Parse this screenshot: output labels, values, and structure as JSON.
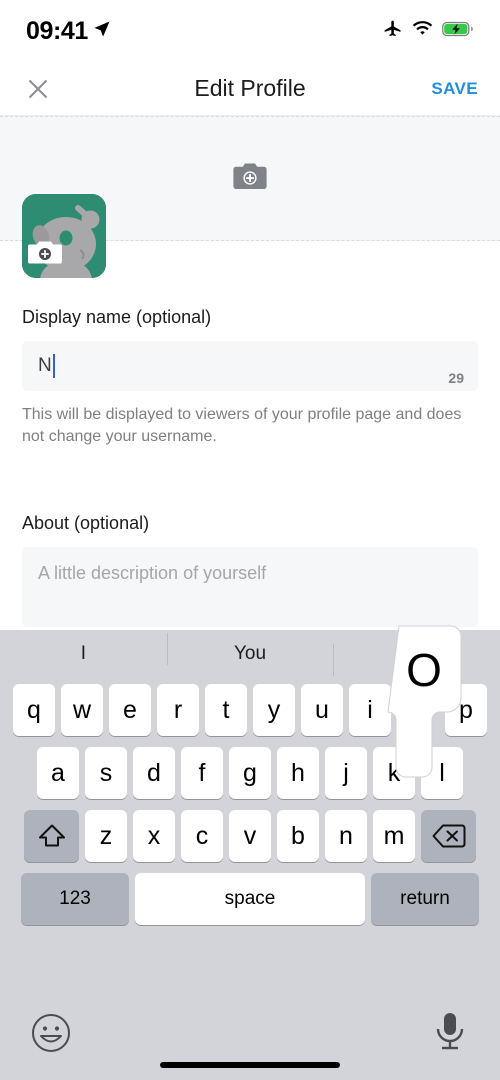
{
  "status_bar": {
    "time": "09:41",
    "location_icon": "location-arrow-icon",
    "airplane_icon": "airplane-mode-icon",
    "wifi_icon": "wifi-icon",
    "battery_icon": "battery-charging-icon",
    "battery_color": "#36C94B"
  },
  "nav": {
    "close_icon": "close-icon",
    "title": "Edit Profile",
    "save_label": "SAVE",
    "save_color": "#1F8FE0"
  },
  "banner": {
    "camera_icon": "camera-add-icon",
    "avatar_badge_icon": "camera-add-icon",
    "avatar_background": "#2E8C72"
  },
  "form": {
    "display_name": {
      "label": "Display name (optional)",
      "value": "N",
      "counter": "29",
      "helper": "This will be displayed to viewers of your profile page and does not change your username."
    },
    "about": {
      "label": "About (optional)",
      "value": "",
      "placeholder": "A little description of yourself"
    }
  },
  "keyboard": {
    "predictions": [
      "I",
      "You",
      ""
    ],
    "row1": [
      "q",
      "w",
      "e",
      "r",
      "t",
      "y",
      "u",
      "i",
      "o",
      "p"
    ],
    "row2": [
      "a",
      "s",
      "d",
      "f",
      "g",
      "h",
      "j",
      "k",
      "l"
    ],
    "row3": [
      "z",
      "x",
      "c",
      "v",
      "b",
      "n",
      "m"
    ],
    "shift_icon": "shift-icon",
    "backspace_icon": "backspace-icon",
    "numbers_label": "123",
    "space_label": "space",
    "return_label": "return",
    "pressed_key": "o",
    "pressed_key_popup": "O",
    "emoji_icon": "emoji-icon",
    "mic_icon": "microphone-icon",
    "background_color": "#D2D4DA"
  }
}
